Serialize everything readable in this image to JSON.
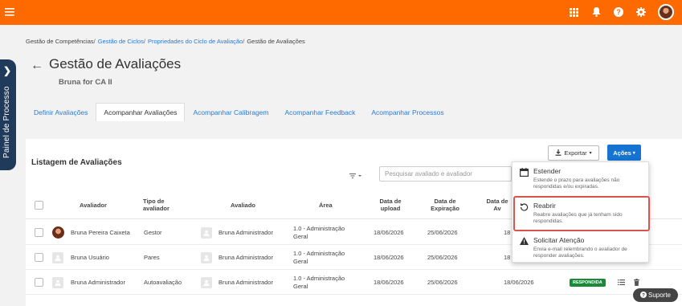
{
  "colors": {
    "topbar": "#ff6a00",
    "accent": "#1573d1",
    "link": "#2a7bd5",
    "sidebar": "#1f3a5a",
    "badge": "#1a8a3a",
    "highlight": "#d9534f"
  },
  "topbar": {
    "menu_icon": "hamburger-icon",
    "icons": [
      "apps-grid-icon",
      "bell-icon",
      "help-icon",
      "gear-icon",
      "user-avatar"
    ]
  },
  "side_panel": {
    "label": "Painel de Processo",
    "icon": "chevron-right-icon"
  },
  "breadcrumb": {
    "items": [
      {
        "label": "Gestão de Competências",
        "link": false
      },
      {
        "label": "Gestão de Ciclos",
        "link": true
      },
      {
        "label": "Propriedades do Ciclo de Avaliação",
        "link": true
      },
      {
        "label": "Gestão de Avaliações",
        "link": false
      }
    ],
    "separator": "/"
  },
  "page": {
    "back_icon": "←",
    "title": "Gestão de Avaliações",
    "subtitle": "Bruna for CA II"
  },
  "tabs": [
    {
      "label": "Definir Avaliações",
      "active": false
    },
    {
      "label": "Acompanhar Avaliações",
      "active": true
    },
    {
      "label": "Acompanhar Calibragem",
      "active": false
    },
    {
      "label": "Acompanhar Feedback",
      "active": false
    },
    {
      "label": "Acompanhar Processos",
      "active": false
    }
  ],
  "listing": {
    "title": "Listagem de Avaliações",
    "export_label": "Exportar",
    "actions_label": "Ações",
    "search_placeholder": "Pesquisar avaliado e avaliador",
    "columns": {
      "avaliador": "Avaliador",
      "tipo": "Tipo de avaliador",
      "avaliado": "Avaliado",
      "area": "Área",
      "upload": "Data de upload",
      "expiracao": "Data de Expiração",
      "resposta": "Data de Av"
    },
    "rows": [
      {
        "avaliador": "Bruna Pereira Caixeta",
        "avaliador_photo": true,
        "tipo": "Gestor",
        "avaliado": "Bruna Administrador",
        "area": "1.0 - Administração Geral",
        "upload": "18/06/2026",
        "expiracao": "25/06/2026",
        "resposta": "18",
        "status": ""
      },
      {
        "avaliador": "Bruna Usuário",
        "avaliador_photo": false,
        "tipo": "Pares",
        "avaliado": "Bruna Administrador",
        "area": "1.0 - Administração Geral",
        "upload": "18/06/2026",
        "expiracao": "25/06/2026",
        "resposta": "18",
        "status": ""
      },
      {
        "avaliador": "Bruna Administrador",
        "avaliador_photo": false,
        "tipo": "Autoavaliação",
        "avaliado": "Bruna Administrador",
        "area": "1.0 - Administração Geral",
        "upload": "18/06/2026",
        "expiracao": "25/06/2026",
        "resposta": "18/06/2026",
        "status": "RESPONDIDA"
      }
    ]
  },
  "actions_menu": [
    {
      "icon": "calendar-icon",
      "title": "Estender",
      "description": "Estende o prazo para avaliações não respondidas e/ou expiradas."
    },
    {
      "icon": "reopen-icon",
      "title": "Reabrir",
      "description": "Reabre avaliações que já tenham sido respondidas."
    },
    {
      "icon": "warning-icon",
      "title": "Solicitar Atenção",
      "description": "Envia e-mail relembrando o avaliador de responder avaliações."
    }
  ],
  "support": {
    "label": "Suporte"
  }
}
